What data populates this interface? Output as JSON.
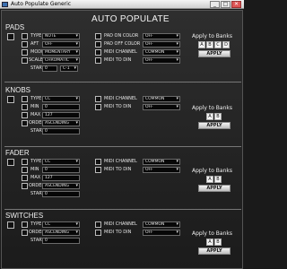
{
  "window": {
    "title": "Auto Populate Generic",
    "minimize": "_",
    "maximize": "□",
    "close": "✕"
  },
  "app_title": "AUTO POPULATE",
  "pads": {
    "title": "PADS",
    "type_label": "TYPE",
    "type_value": "NOTE",
    "aft_label": "AFT",
    "aft_value": "OFF",
    "mode_label": "MODE",
    "mode_value": "MOMENTARY",
    "scale_label": "SCALE",
    "scale_value": "CHROMATIC",
    "start_label": "START",
    "start_value": "0",
    "start_note": "C-1",
    "pad_on_color_label": "PAD ON COLOR",
    "pad_on_color_value": "OFF",
    "pad_off_color_label": "PAD OFF COLOR",
    "pad_off_color_value": "OFF",
    "midi_channel_label": "MIDI CHANNEL",
    "midi_channel_value": "COMMON",
    "midi_to_din_label": "MIDI TO DIN",
    "midi_to_din_value": "OFF",
    "apply_to_banks_label": "Apply to Banks",
    "banks": [
      "A",
      "B",
      "C",
      "D"
    ],
    "apply_label": "APPLY"
  },
  "knobs": {
    "title": "KNOBS",
    "type_label": "TYPE",
    "type_value": "CC",
    "min_label": "MIN",
    "min_value": "0",
    "max_label": "MAX",
    "max_value": "127",
    "order_label": "ORDER",
    "order_value": "ASCENDING",
    "start_label": "START",
    "start_value": "0",
    "midi_channel_label": "MIDI CHANNEL",
    "midi_channel_value": "COMMON",
    "midi_to_din_label": "MIDI TO DIN",
    "midi_to_din_value": "OFF",
    "apply_to_banks_label": "Apply to Banks",
    "banks": [
      "A",
      "B"
    ],
    "apply_label": "APPLY"
  },
  "fader": {
    "title": "FADER",
    "type_label": "TYPE",
    "type_value": "CC",
    "min_label": "MIN",
    "min_value": "0",
    "max_label": "MAX",
    "max_value": "127",
    "order_label": "ORDER",
    "order_value": "ASCENDING",
    "start_label": "START",
    "start_value": "0",
    "midi_channel_label": "MIDI CHANNEL",
    "midi_channel_value": "COMMON",
    "midi_to_din_label": "MIDI TO DIN",
    "midi_to_din_value": "OFF",
    "apply_to_banks_label": "Apply to Banks",
    "banks": [
      "A",
      "B"
    ],
    "apply_label": "APPLY"
  },
  "switches": {
    "title": "SWITCHES",
    "type_label": "TYPE",
    "type_value": "CC",
    "order_label": "ORDER",
    "order_value": "ASCENDING",
    "start_label": "START",
    "start_value": "0",
    "midi_channel_label": "MIDI CHANNEL",
    "midi_channel_value": "COMMON",
    "midi_to_din_label": "MIDI TO DIN",
    "midi_to_din_value": "OFF",
    "apply_to_banks_label": "Apply to Banks",
    "banks": [
      "A",
      "B"
    ],
    "apply_label": "APPLY"
  }
}
